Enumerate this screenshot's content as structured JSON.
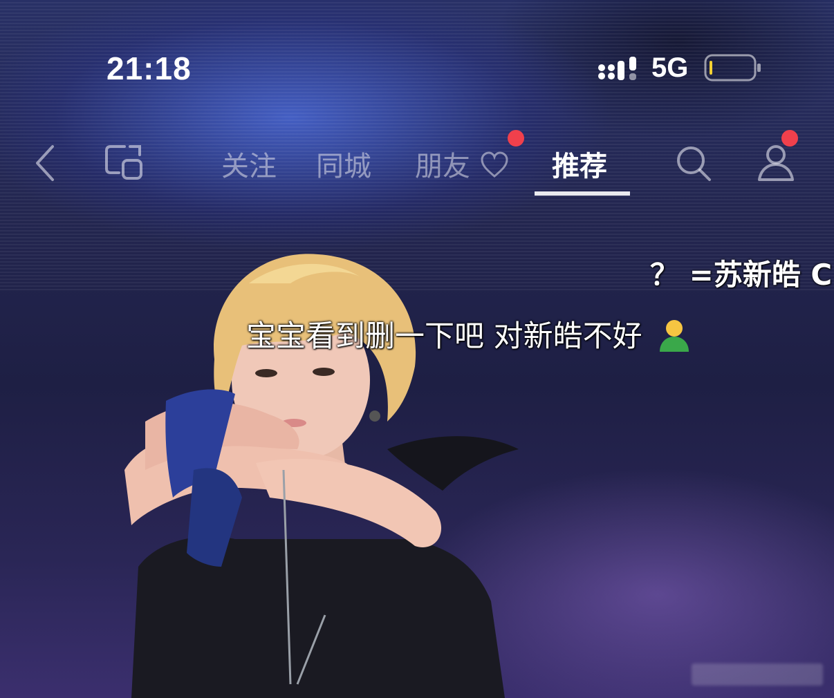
{
  "status_bar": {
    "time": "21:18",
    "network": "5G",
    "icons": [
      "signal-icon",
      "battery-icon"
    ]
  },
  "nav": {
    "back_icon": "chevron-left-icon",
    "multi_screen_icon": "screen-switch-icon",
    "tabs": [
      {
        "label": "关注",
        "active": false
      },
      {
        "label": "同城",
        "active": false
      },
      {
        "label": "朋友",
        "active": false,
        "badge": true
      },
      {
        "label": "推荐",
        "active": true
      }
    ],
    "search_icon": "search-icon",
    "profile_icon": "user-icon"
  },
  "video": {
    "caption": "宝宝看到删一下吧 对新皓不好",
    "caption_emoji": "person-emoji",
    "side_text": "？ =苏新皓 C"
  },
  "colors": {
    "badge": "#f0404c",
    "text": "#ffffff"
  }
}
